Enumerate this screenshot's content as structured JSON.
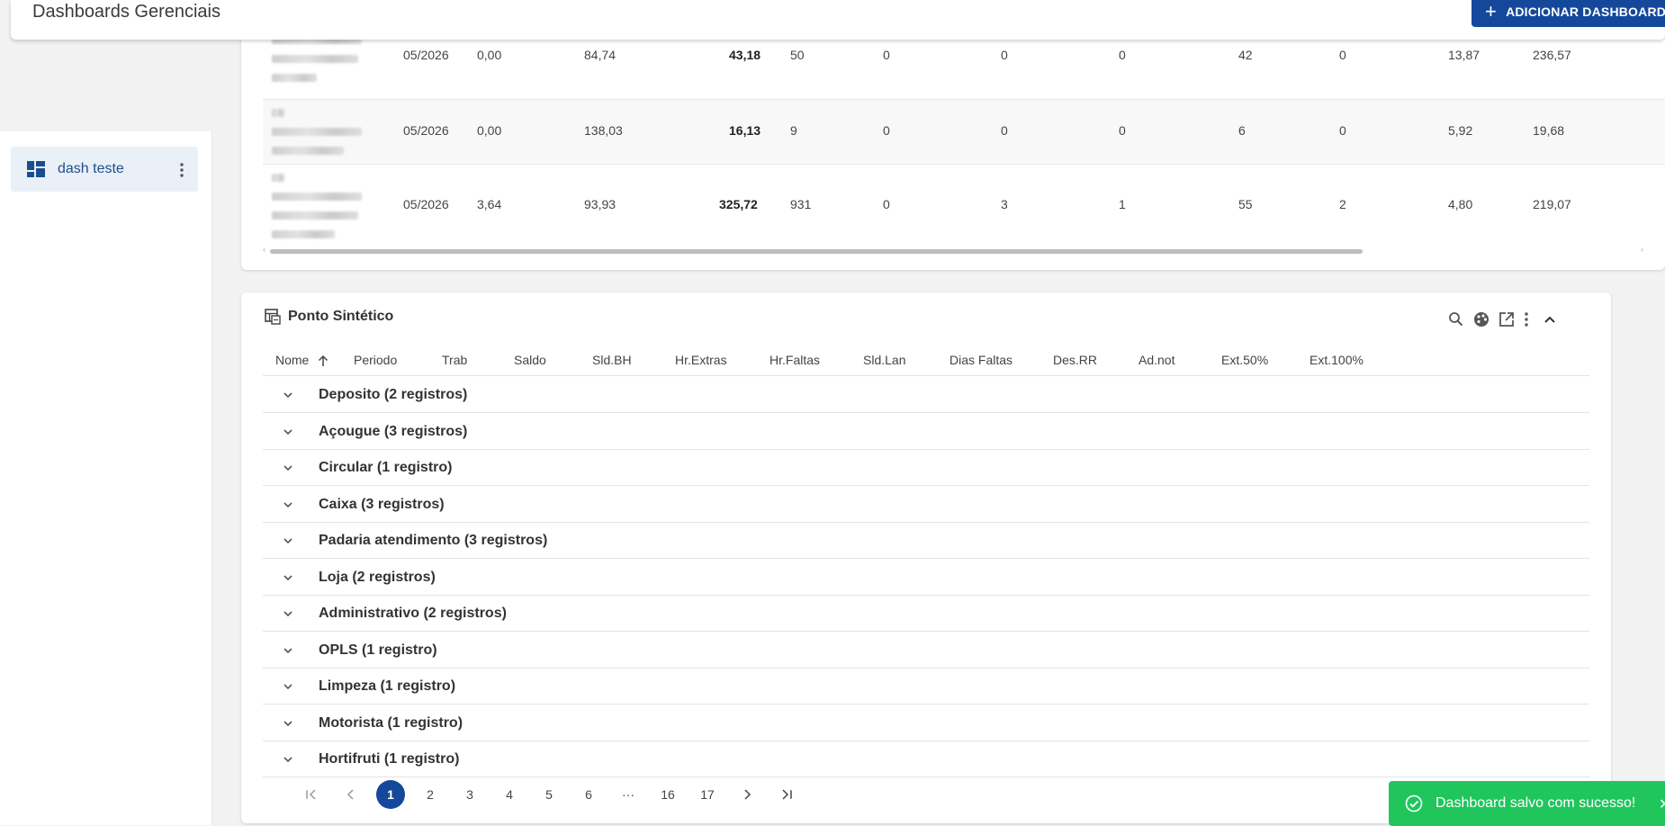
{
  "header": {
    "title": "Dashboards Gerenciais",
    "add_button": "ADICIONAR DASHBOARD"
  },
  "sidebar": {
    "items": [
      {
        "label": "dash teste"
      }
    ]
  },
  "top_table": {
    "rows": [
      {
        "periodo": "05/2026",
        "c1": "0,00",
        "c2": "84,74",
        "c3": "43,18",
        "c4": "50",
        "c5": "0",
        "c6": "0",
        "c7": "0",
        "c8": "42",
        "c9": "0",
        "c10": "13,87",
        "c11": "236,57"
      },
      {
        "periodo": "05/2026",
        "c1": "0,00",
        "c2": "138,03",
        "c3": "16,13",
        "c4": "9",
        "c5": "0",
        "c6": "0",
        "c7": "0",
        "c8": "6",
        "c9": "0",
        "c10": "5,92",
        "c11": "19,68"
      },
      {
        "periodo": "05/2026",
        "c1": "3,64",
        "c2": "93,93",
        "c3": "325,72",
        "c4": "931",
        "c5": "0",
        "c6": "3",
        "c7": "1",
        "c8": "55",
        "c9": "2",
        "c10": "4,80",
        "c11": "219,07"
      }
    ]
  },
  "ponto": {
    "title": "Ponto Sintético",
    "columns": [
      "Nome",
      "Periodo",
      "Trab",
      "Saldo",
      "Sld.BH",
      "Hr.Extras",
      "Hr.Faltas",
      "Sld.Lan",
      "Dias Faltas",
      "Des.RR",
      "Ad.not",
      "Ext.50%",
      "Ext.100%"
    ],
    "groups": [
      "Deposito (2 registros)",
      "Açougue (3 registros)",
      "Circular (1 registro)",
      "Caixa (3 registros)",
      "Padaria atendimento (3 registros)",
      "Loja (2 registros)",
      "Administrativo (2 registros)",
      "OPLS (1 registro)",
      "Limpeza (1 registro)",
      "Motorista (1 registro)",
      "Hortifruti (1 registro)"
    ],
    "pagination": {
      "pages": [
        "1",
        "2",
        "3",
        "4",
        "5",
        "6",
        "···",
        "16",
        "17"
      ],
      "current": "1"
    }
  },
  "toast": {
    "message": "Dashboard salvo com sucesso!"
  }
}
